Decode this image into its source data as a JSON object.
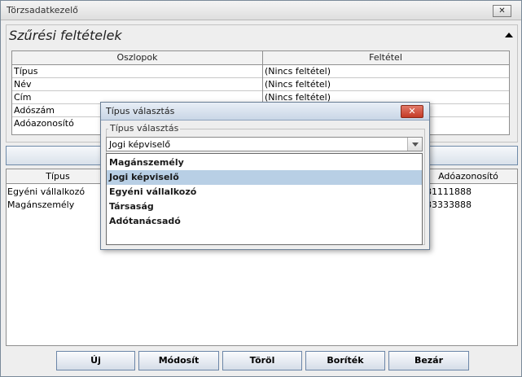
{
  "window": {
    "title": "Törzsadatkezelő",
    "close_glyph": "✕"
  },
  "filter": {
    "section_title": "Szűrési feltételek",
    "columns_header": "Oszlopok",
    "condition_header": "Feltétel",
    "rows": [
      {
        "column": "Típus",
        "condition": "(Nincs feltétel)"
      },
      {
        "column": "Név",
        "condition": "(Nincs feltétel)"
      },
      {
        "column": "Cím",
        "condition": "(Nincs feltétel)"
      },
      {
        "column": "Adószám",
        "condition": ""
      },
      {
        "column": "Adóazonosító",
        "condition": ""
      }
    ]
  },
  "results": {
    "headers": [
      "Típus",
      "Adóazonosító"
    ],
    "rows": [
      {
        "type": "Egyéni vállalkozó",
        "tax_id": "881111888"
      },
      {
        "type": "Magánszemély",
        "tax_id": "883333888"
      }
    ]
  },
  "buttons": {
    "new": "Új",
    "modify": "Módosít",
    "delete": "Töröl",
    "envelope": "Boríték",
    "close": "Bezár"
  },
  "dialog": {
    "title": "Típus választás",
    "close_glyph": "✕",
    "group_label": "Típus választás",
    "selected": "Jogi képviselő",
    "options": [
      "Magánszemély",
      "Jogi képviselő",
      "Egyéni vállalkozó",
      "Társaság",
      "Adótanácsadó"
    ]
  },
  "colors": {
    "selection": "#b8cfe5",
    "button_border": "#6c86a8",
    "dialog_close": "#c43a26"
  },
  "icons": {
    "collapse": "triangle-up-icon",
    "dropdown": "chevron-down-icon"
  }
}
